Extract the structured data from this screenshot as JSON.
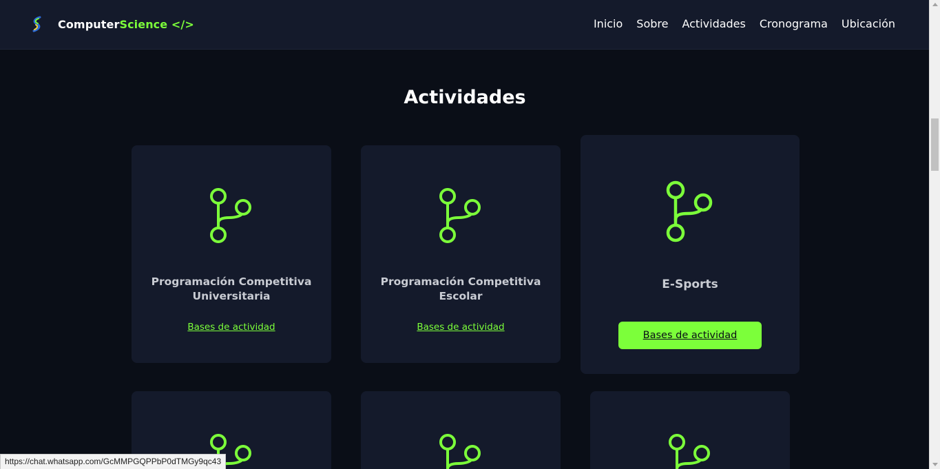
{
  "header": {
    "brand_prefix": "Computer",
    "brand_accent": "Science </>",
    "nav": [
      {
        "label": "Inicio"
      },
      {
        "label": "Sobre"
      },
      {
        "label": "Actividades"
      },
      {
        "label": "Cronograma"
      },
      {
        "label": "Ubicación"
      }
    ]
  },
  "main": {
    "section_title": "Actividades",
    "cards": [
      {
        "title_line1": "Programación Competitiva",
        "title_line2": "Universitaria",
        "link_label": "Bases de actividad",
        "icon": "git-branch-icon"
      },
      {
        "title_line1": "Programación Competitiva",
        "title_line2": "Escolar",
        "link_label": "Bases de actividad",
        "icon": "git-branch-icon"
      },
      {
        "title_line1": "E-Sports",
        "link_label": "Bases de actividad",
        "icon": "git-branch-icon",
        "state": "hovered"
      },
      {
        "icon": "git-branch-icon"
      },
      {
        "icon": "git-branch-icon"
      },
      {
        "icon": "git-branch-icon"
      }
    ]
  },
  "status_bar": {
    "url": "https://chat.whatsapp.com/GcMMPGQPPbP0dTMGy9qc43"
  },
  "colors": {
    "accent": "#7cff3a",
    "background": "#0a0e17",
    "card": "#141a2b",
    "header": "#141a2b"
  }
}
